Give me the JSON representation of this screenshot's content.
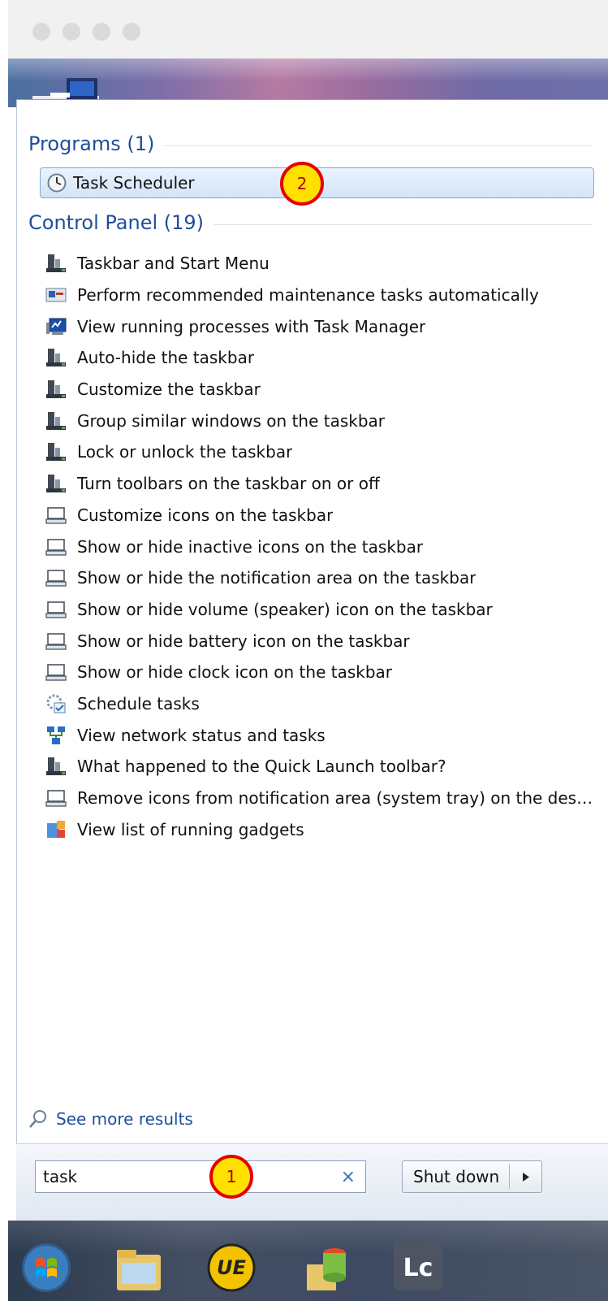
{
  "programs": {
    "header": "Programs (1)",
    "items": [
      {
        "label": "Task Scheduler",
        "icon": "clock-icon"
      }
    ]
  },
  "control_panel": {
    "header": "Control Panel (19)",
    "items": [
      {
        "label": "Taskbar and Start Menu",
        "icon": "taskbar-icon"
      },
      {
        "label": "Perform recommended maintenance tasks automatically",
        "icon": "action-center-icon"
      },
      {
        "label": "View running processes with Task Manager",
        "icon": "task-manager-icon"
      },
      {
        "label": "Auto-hide the taskbar",
        "icon": "taskbar-icon"
      },
      {
        "label": "Customize the taskbar",
        "icon": "taskbar-icon"
      },
      {
        "label": "Group similar windows on the taskbar",
        "icon": "taskbar-icon"
      },
      {
        "label": "Lock or unlock the taskbar",
        "icon": "taskbar-icon"
      },
      {
        "label": "Turn toolbars on the taskbar on or off",
        "icon": "taskbar-icon"
      },
      {
        "label": "Customize icons on the taskbar",
        "icon": "notification-area-icon"
      },
      {
        "label": "Show or hide inactive icons on the taskbar",
        "icon": "notification-area-icon"
      },
      {
        "label": "Show or hide the notification area on the taskbar",
        "icon": "notification-area-icon"
      },
      {
        "label": "Show or hide volume (speaker) icon on the taskbar",
        "icon": "notification-area-icon"
      },
      {
        "label": "Show or hide battery icon on the taskbar",
        "icon": "notification-area-icon"
      },
      {
        "label": "Show or hide clock icon on the taskbar",
        "icon": "notification-area-icon"
      },
      {
        "label": "Schedule tasks",
        "icon": "schedule-icon"
      },
      {
        "label": "View network status and tasks",
        "icon": "network-icon"
      },
      {
        "label": "What happened to the Quick Launch toolbar?",
        "icon": "taskbar-icon"
      },
      {
        "label": "Remove icons from notification area (system tray) on the deskt...",
        "icon": "notification-area-icon"
      },
      {
        "label": "View list of running gadgets",
        "icon": "gadgets-icon"
      }
    ]
  },
  "see_more": "See more results",
  "search": {
    "value": "task",
    "clear_symbol": "×"
  },
  "shutdown": {
    "label": "Shut down"
  },
  "callouts": {
    "one": "1",
    "two": "2"
  },
  "colors": {
    "header_blue": "#1f4e9c",
    "badge_fill": "#ffe000",
    "badge_ring": "#e20000"
  }
}
